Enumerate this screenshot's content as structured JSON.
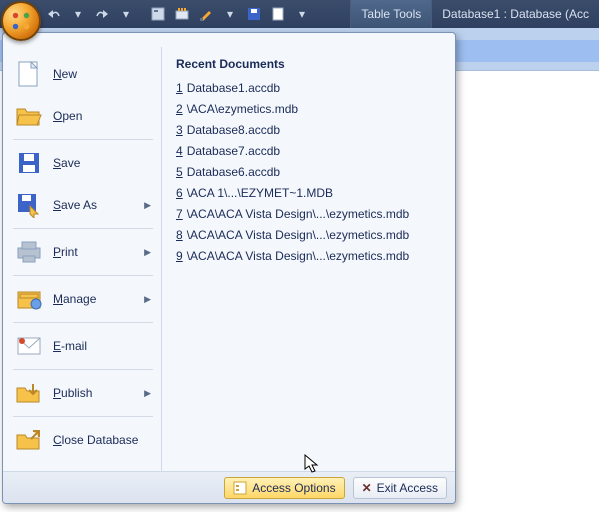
{
  "titlebar": {
    "tabtools": "Table Tools",
    "dbtitle": "Database1 : Database (Acc"
  },
  "menu": {
    "items": [
      {
        "label": "New",
        "arrow": false
      },
      {
        "label": "Open",
        "arrow": false
      },
      {
        "label": "Save",
        "arrow": false
      },
      {
        "label": "Save As",
        "arrow": true
      },
      {
        "label": "Print",
        "arrow": true
      },
      {
        "label": "Manage",
        "arrow": true
      },
      {
        "label": "E-mail",
        "arrow": false
      },
      {
        "label": "Publish",
        "arrow": true
      },
      {
        "label": "Close Database",
        "arrow": false
      }
    ],
    "recent_header": "Recent Documents",
    "recent": [
      {
        "n": "1",
        "label": "Database1.accdb"
      },
      {
        "n": "2",
        "label": "\\ACA\\ezymetics.mdb"
      },
      {
        "n": "3",
        "label": "Database8.accdb"
      },
      {
        "n": "4",
        "label": "Database7.accdb"
      },
      {
        "n": "5",
        "label": "Database6.accdb"
      },
      {
        "n": "6",
        "label": "\\ACA 1\\...\\EZYMET~1.MDB"
      },
      {
        "n": "7",
        "label": "\\ACA\\ACA Vista Design\\...\\ezymetics.mdb"
      },
      {
        "n": "8",
        "label": "\\ACA\\ACA Vista Design\\...\\ezymetics.mdb"
      },
      {
        "n": "9",
        "label": "\\ACA\\ACA Vista Design\\...\\ezymetics.mdb"
      }
    ],
    "footer": {
      "options": "Access Options",
      "exit": "Exit Access"
    }
  }
}
